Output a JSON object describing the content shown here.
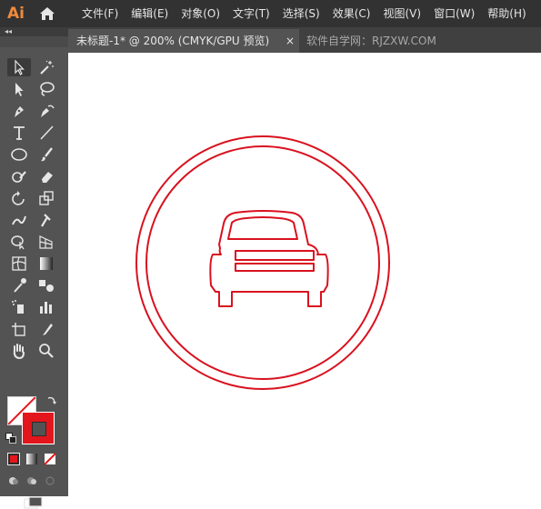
{
  "app": {
    "logo": "Ai"
  },
  "menu": {
    "items": [
      "文件(F)",
      "编辑(E)",
      "对象(O)",
      "文字(T)",
      "选择(S)",
      "效果(C)",
      "视图(V)",
      "窗口(W)",
      "帮助(H)"
    ]
  },
  "tabs": {
    "active": "未标题-1* @ 200% (CMYK/GPU 预览)",
    "close": "×",
    "inactive": "软件自学网：RJZXW.COM"
  },
  "toolbar": {
    "collapse": "◂◂"
  },
  "colors": {
    "menubar": "#323232",
    "toolbar": "#535353",
    "stroke": "#e3161d",
    "artwork": "#d9121f",
    "logo": "#ee8a3b"
  },
  "artwork": {
    "icon": "car-in-circle-icon"
  }
}
